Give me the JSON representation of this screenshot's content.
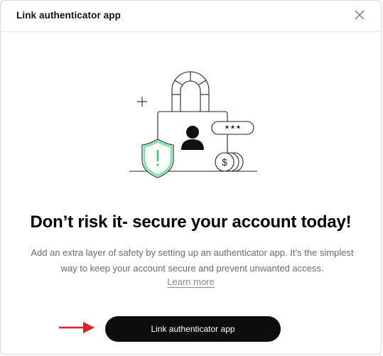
{
  "dialog": {
    "title": "Link authenticator app",
    "close_icon": "close-icon"
  },
  "illustration": {
    "password_mask": "* * *",
    "icons": [
      "padlock-icon",
      "user-icon",
      "shield-warning-icon",
      "coins-icon",
      "plus-icon"
    ],
    "shield_color": "#6ee79a"
  },
  "content": {
    "headline": "Don’t risk it- secure your account today!",
    "description": "Add an extra layer of safety by setting up an authenticator app. It’s the simplest way to keep your account secure and prevent unwanted access.",
    "learn_more": "Learn more"
  },
  "actions": {
    "primary_label": "Link authenticator app",
    "primary_color": "#0d0d0d"
  },
  "annotation": {
    "arrow_color": "#e02020",
    "icon": "red-arrow-icon"
  }
}
